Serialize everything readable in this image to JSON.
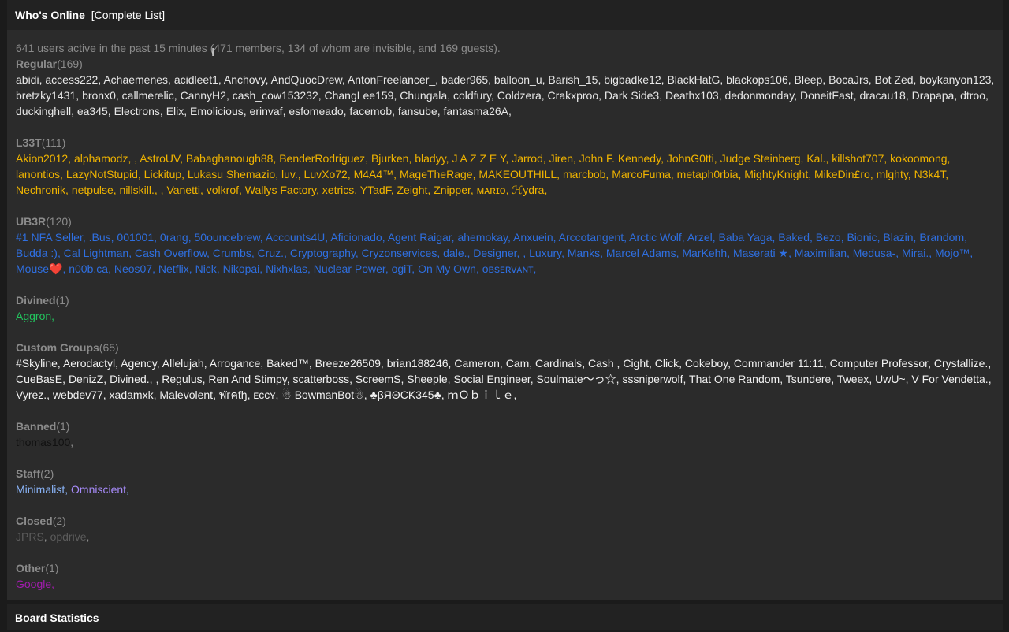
{
  "header": {
    "title": "Who's Online",
    "link": "[Complete List]"
  },
  "summary": "641 users active in the past 15 minutes (471 members, 134 of whom are invisible, and 169 guests).",
  "groups": [
    {
      "name": "Regular",
      "count": "(169)",
      "color": "#e8e8e8",
      "users": [
        "abidi",
        "access222",
        "Achaemenes",
        "acidleet1",
        "Anchovy",
        "AndQuocDrew",
        "AntonFreelancer_",
        "bader965",
        "balloon_u",
        "Barish_15",
        "bigbadke12",
        "BlackHatG",
        "blackops106",
        "Bleep",
        "BocaJrs",
        "Bot Zed",
        "boykanyon123",
        "bretzky1431",
        "bronx0",
        "callmerelic",
        "CannyH2",
        "cash_cow153232",
        "ChangLee159",
        "Chungala",
        "coldfury",
        "Coldzera",
        "Crakxproo",
        "Dark Side3",
        "Deathx103",
        "dedonmonday",
        "DoneitFast",
        "dracau18",
        "Drapapa",
        "dtroo",
        "duckinghell",
        "ea345",
        "Electrons",
        "Elix",
        "Emolicious",
        "erinvaf",
        "esfomeado",
        "facemob",
        "fansube",
        "fantasma26A"
      ]
    },
    {
      "name": "L33T",
      "count": "(111)",
      "color": "#f0b400",
      "users": [
        "Akion2012",
        "alphamodz",
        "",
        "AstroUV",
        "Babaghanough88",
        "BenderRodriguez",
        "Bjurken",
        "bladyy",
        "J A Z Z E Y",
        "Jarrod",
        "Jiren",
        "John F. Kennedy",
        "JohnG0tti",
        "Judge Steinberg",
        "Kal.",
        "killshot707",
        "kokoomong",
        "lanontios",
        "LazyNotStupid",
        "Lickitup",
        "Lukasu Shemazio",
        "luv.",
        "LuvXo72",
        "M4A4™",
        "MageTheRage",
        "MAKEOUTHILL",
        "marcbob",
        "MarcoFuma",
        "metaph0rbia",
        "MightyKnight",
        "MikeDin£ro",
        "mlghty",
        "N3k4T",
        "Nechronik",
        "netpulse",
        "nillskill.",
        "",
        "Vanetti",
        "volkrof",
        "Wallys Factory",
        "xetrics",
        "YTadF",
        "Zeight",
        "Znipper",
        "ᴍᴀʀɪᴏ",
        "ℋydra"
      ]
    },
    {
      "name": "UB3R",
      "count": "(120)",
      "color": "#2f6fe0",
      "users": [
        "#1 NFA Seller",
        ".Bus",
        "001001",
        "0rang",
        "50ouncebrew",
        "Accounts4U",
        "Aficionado",
        "Agent Raigar",
        "ahemokay",
        "Anxuein",
        "Arccotangent",
        "Arctic Wolf",
        "Arzel",
        "Baba Yaga",
        "Baked",
        "Bezo",
        "Bionic",
        "Blazin",
        "Brandom",
        "Budda :)",
        "Cal Lightman",
        "Cash Overflow",
        "Crumbs",
        "Cruz.",
        "Cryptography",
        "Cryzonservices",
        "dale.",
        "Designer",
        "",
        "Luxury",
        "Manks",
        "Marcel Adams",
        "MarKehh",
        "Maserati ★",
        "Maximilian",
        "Medusa-",
        "Mirai.",
        "Mojo™",
        "Mouse❤️",
        "n00b.ca",
        "Neos07",
        "Netflix",
        "Nick",
        "Nikopai",
        "Nixhxlas",
        "Nuclear Power",
        "ogiT",
        "On My Own",
        "ᴏʙsᴇʀᴠᴀɴᴛ"
      ]
    },
    {
      "name": "Divined",
      "count": "(1)",
      "color": "#22c55e",
      "users": [
        "Aggron"
      ]
    },
    {
      "name": "Custom Groups",
      "count": "(65)",
      "color": "#f2f2f2",
      "users": [
        "#Skyline",
        "Aerodactyl",
        "Agency",
        "Allelujah",
        "Arrogance",
        "Baked™",
        "Breeze26509",
        "brian188246",
        "Cameron",
        "Cam",
        "Cardinals",
        "Cash ",
        "Cight",
        "Click",
        "Cokeboy",
        "Commander 11:11",
        "Computer Professor",
        "Crystallize.",
        "CueBasE",
        "DenizZ",
        "Divined.",
        "",
        "Regulus",
        "Ren And Stimpy",
        "scatterboss",
        "ScreemS",
        "Sheeple",
        "Social Engineer",
        "Soulmate〜っ☆",
        "sssniperwolf",
        "That One Random",
        "Tsundere",
        "Tweex",
        "UwU~",
        "V For Vendetta.",
        "Vyrez.",
        "webdev77",
        "xadamxk",
        "Malevolent",
        "ฬгคƭђ",
        "ᴇᴄᴄʏ",
        "☃ BowmanBot☃",
        "♣βЯΘCK345♣",
        "ｍＯｂｉｌｅ"
      ]
    },
    {
      "name": "Banned",
      "count": "(1)",
      "color": "#111111",
      "users": [
        "thomas100"
      ]
    },
    {
      "name": "Staff",
      "count": "(2)",
      "color": "#8ab4f8",
      "user_colors": [
        "#8ab4f8",
        "#a78bfa"
      ],
      "users": [
        "Minimalist",
        "Omniscient"
      ]
    },
    {
      "name": "Closed",
      "count": "(2)",
      "color": "#5c5c5c",
      "users": [
        "JPRS",
        "opdrive"
      ]
    },
    {
      "name": "Other",
      "count": "(1)",
      "color": "#a21caf",
      "users": [
        "Google"
      ]
    }
  ],
  "footer": {
    "title": "Board Statistics"
  },
  "cursor_icon": "text-cursor-icon"
}
